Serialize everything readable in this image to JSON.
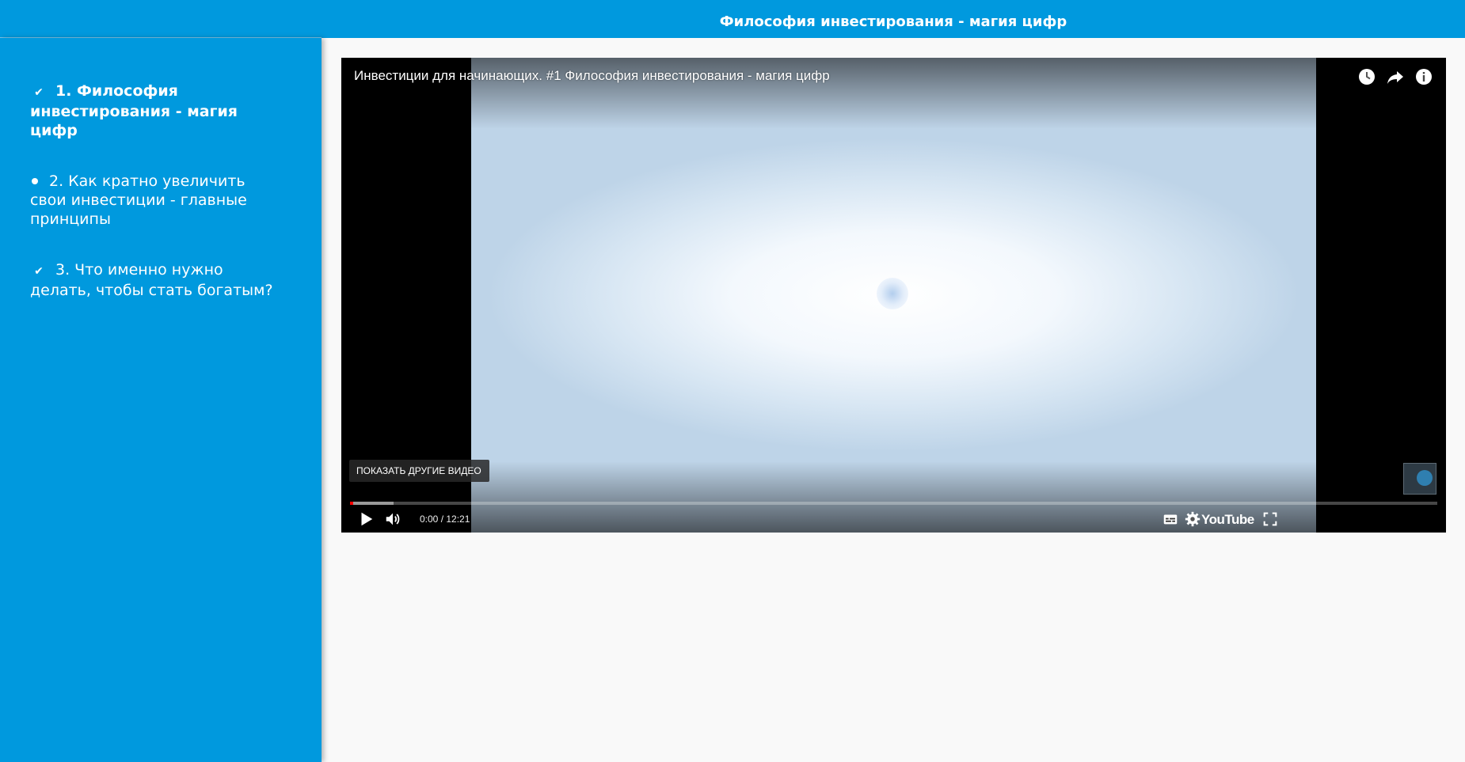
{
  "header": {
    "title": "Философия инвестирования - магия цифр"
  },
  "sidebar": {
    "items": [
      {
        "label": "1. Философия инвестирования - магия цифр",
        "marker": "check",
        "active": true
      },
      {
        "label": "2. Как кратно увеличить свои инвестиции - главные принципы",
        "marker": "dot",
        "active": false
      },
      {
        "label": "3. Что именно нужно делать, чтобы стать богатым?",
        "marker": "check",
        "active": false
      }
    ]
  },
  "player": {
    "title": "Инвестиции для начинающих. #1 Философия инвестирования - магия цифр",
    "more_videos_label": "ПОКАЗАТЬ ДРУГИЕ ВИДЕО",
    "time": "0:00 / 12:21",
    "logo_text": "YouTube",
    "progress_played": 0.002,
    "progress_buffered": 0.04,
    "top_icons": [
      "watch-later-icon",
      "share-icon",
      "info-icon"
    ],
    "colors": {
      "accent": "#0099de",
      "progress": "#ff0000"
    }
  }
}
